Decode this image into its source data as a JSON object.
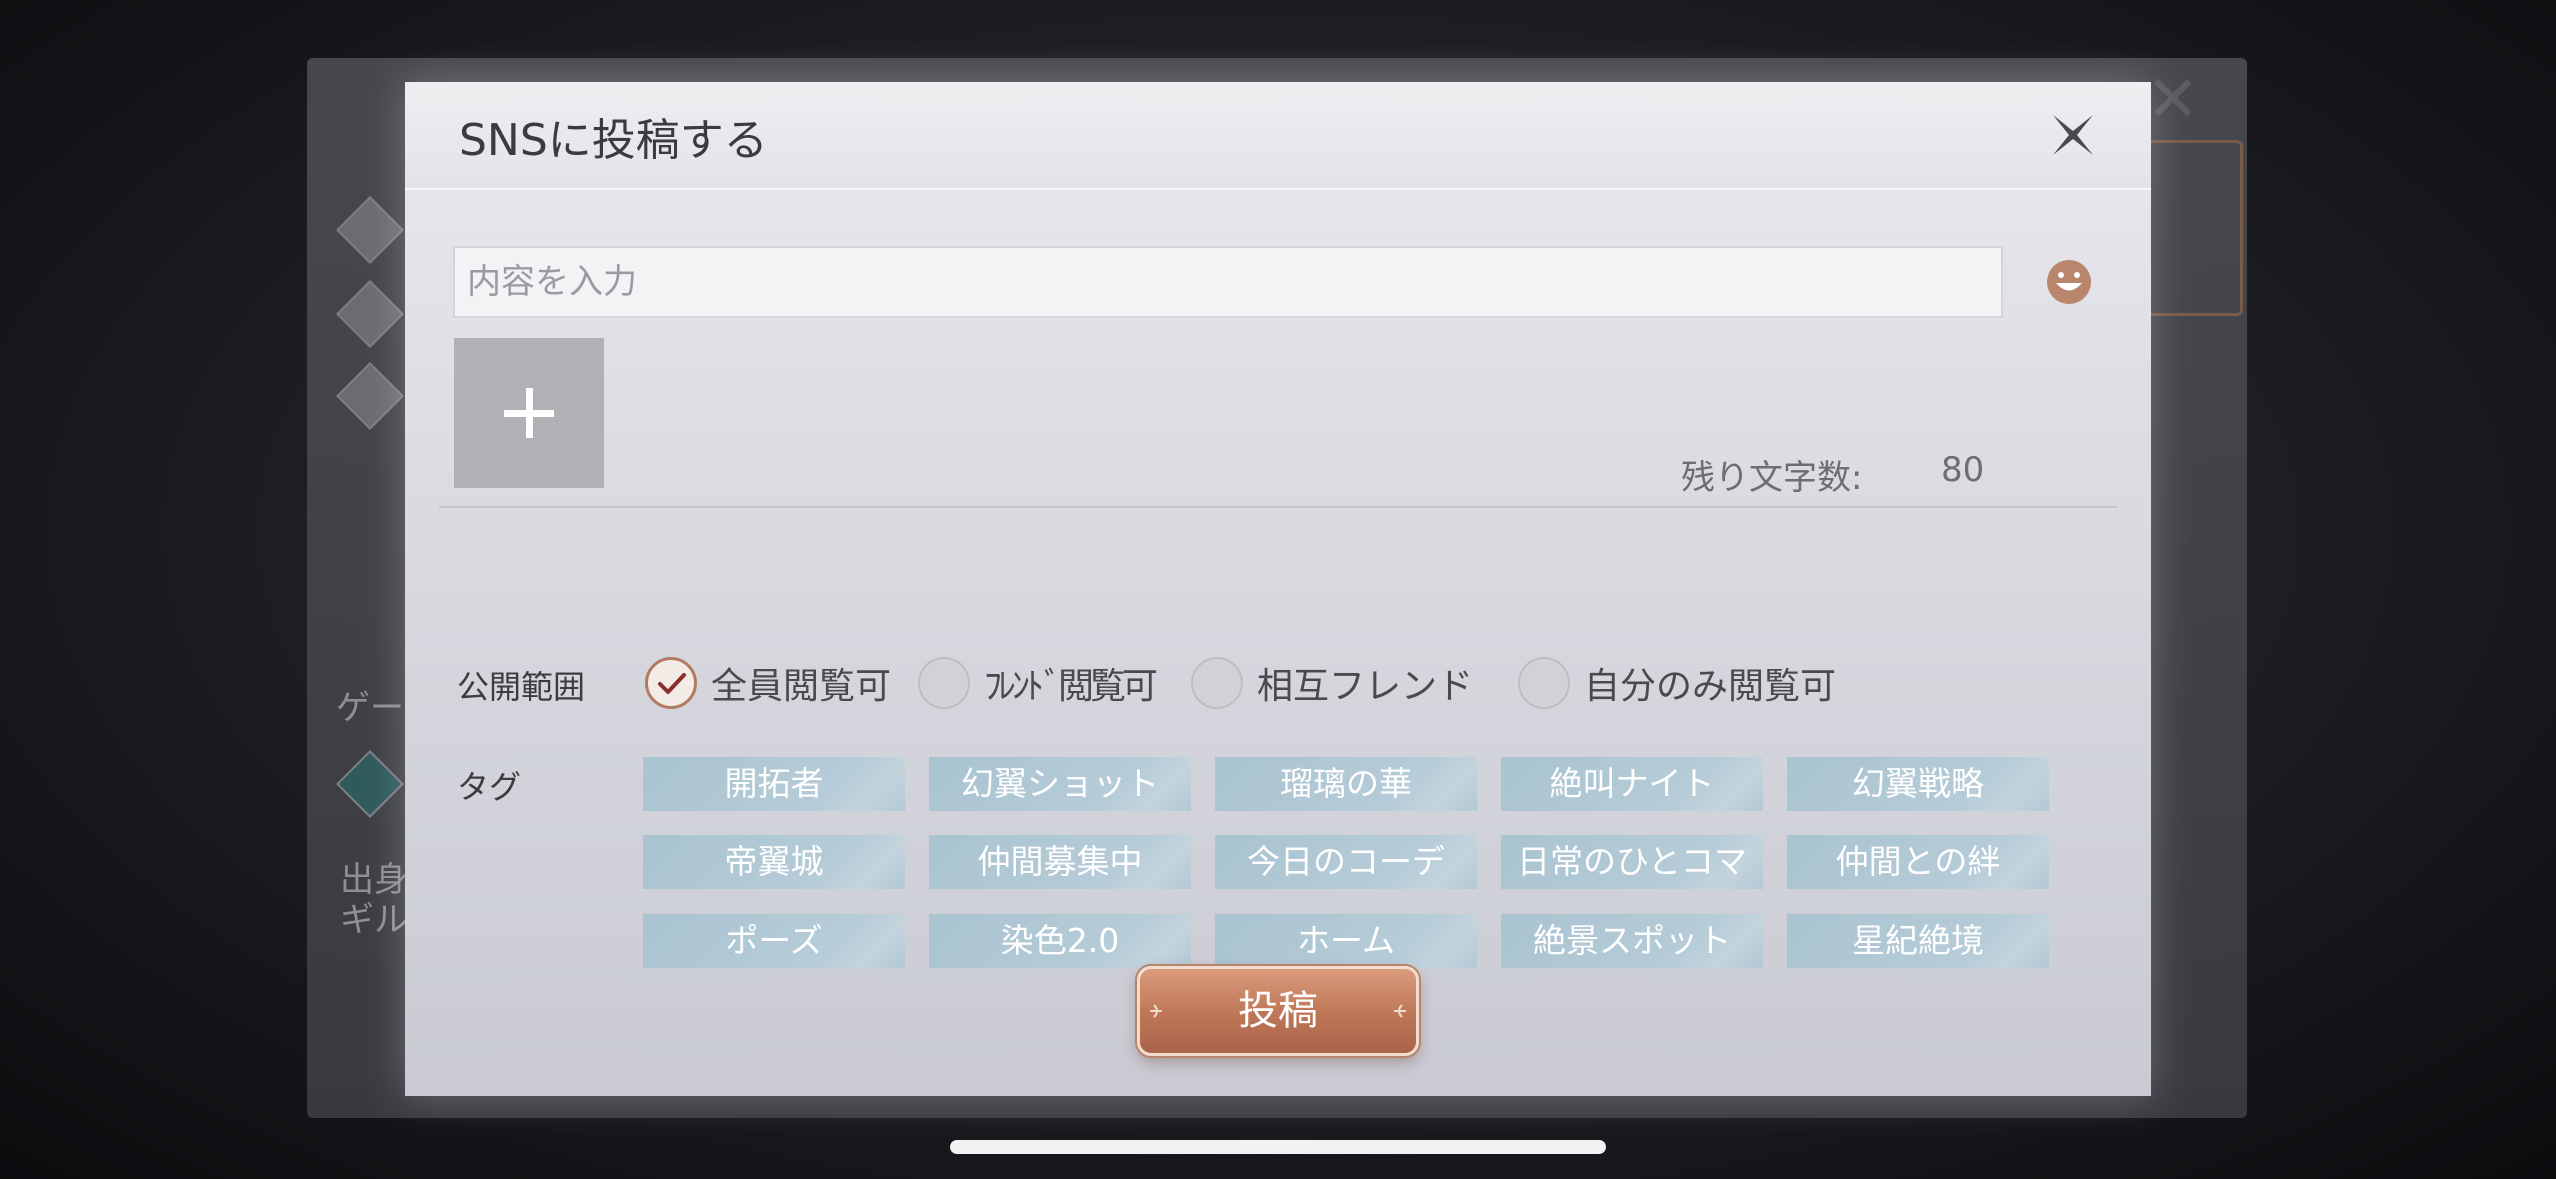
{
  "dialog": {
    "title": "SNSに投稿する",
    "input_placeholder": "内容を入力",
    "char_count_label": "残り文字数:",
    "char_count_value": "80"
  },
  "visibility": {
    "label": "公開範囲",
    "options": [
      {
        "label": "全員閲覧可",
        "checked": true
      },
      {
        "label": "ﾌﾚﾝﾄﾞ閲覧可",
        "checked": false
      },
      {
        "label": "相互フレンド",
        "checked": false
      },
      {
        "label": "自分のみ閲覧可",
        "checked": false
      }
    ]
  },
  "tags": {
    "label": "タグ",
    "items": [
      "開拓者",
      "幻翼ショット",
      "瑠璃の華",
      "絶叫ナイト",
      "幻翼戦略",
      "帝翼城",
      "仲間募集中",
      "今日のコーデ",
      "日常のひとコマ",
      "仲間との絆",
      "ポーズ",
      "染色2.0",
      "ホーム",
      "絶景スポット",
      "星紀絶境"
    ]
  },
  "submit_label": "投稿",
  "background": {
    "partial_texts": [
      "ゲー",
      "出身",
      "ギル"
    ]
  },
  "colors": {
    "accent": "#bd7656",
    "tag_bg": "#b6ccd8",
    "check": "#8a2f2a"
  }
}
